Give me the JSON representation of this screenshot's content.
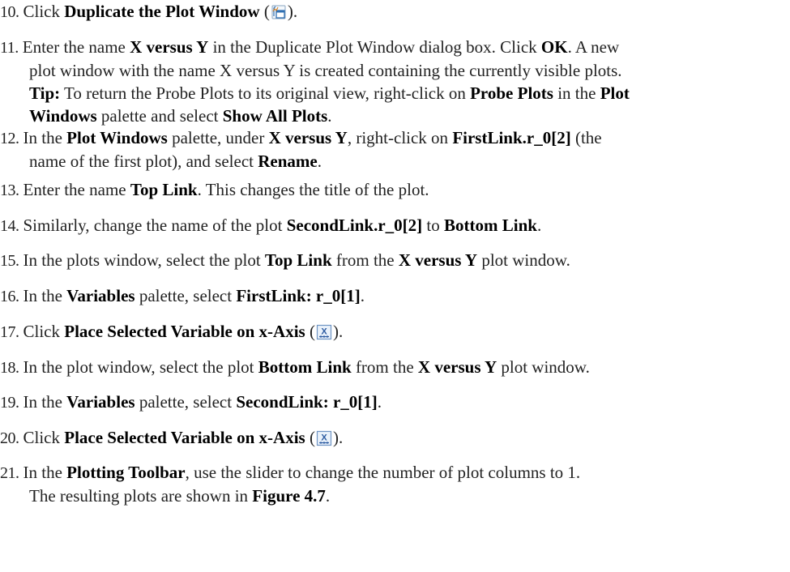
{
  "steps": [
    {
      "num": "10.",
      "lines": [
        [
          {
            "t": "Click "
          },
          {
            "t": "Duplicate the Plot Window",
            "b": true
          },
          {
            "t": " ("
          },
          {
            "icon": "duplicate-window-icon"
          },
          {
            "t": ")."
          }
        ]
      ]
    },
    {
      "num": "11.",
      "lines": [
        [
          {
            "t": "Enter the name "
          },
          {
            "t": "X versus Y",
            "b": true
          },
          {
            "t": " in the Duplicate Plot Window dialog box. Click "
          },
          {
            "t": "OK",
            "b": true
          },
          {
            "t": ". A new"
          }
        ],
        [
          {
            "t": "plot window with the name X versus Y is created containing the currently visible plots."
          }
        ],
        [
          {
            "t": "Tip:",
            "b": true
          },
          {
            "t": " To return the Probe Plots to its original view, right-click on "
          },
          {
            "t": "Probe Plots",
            "b": true
          },
          {
            "t": " in the "
          },
          {
            "t": "Plot",
            "b": true
          }
        ],
        [
          {
            "t": "Windows",
            "b": true
          },
          {
            "t": " palette and select "
          },
          {
            "t": "Show All Plots",
            "b": true
          },
          {
            "t": "."
          }
        ]
      ]
    },
    {
      "num": "12.",
      "lines": [
        [
          {
            "t": "In the "
          },
          {
            "t": "Plot Windows",
            "b": true
          },
          {
            "t": " palette, under "
          },
          {
            "t": "X versus Y",
            "b": true
          },
          {
            "t": ", right-click on "
          },
          {
            "t": "FirstLink.r_0[2]",
            "b": true
          },
          {
            "t": " (the"
          }
        ],
        [
          {
            "t": "name of the first plot), and select "
          },
          {
            "t": "Rename",
            "b": true
          },
          {
            "t": "."
          }
        ]
      ]
    },
    {
      "num": "13.",
      "lines": [
        [
          {
            "t": "Enter the name "
          },
          {
            "t": "Top Link",
            "b": true
          },
          {
            "t": ". This changes the title of the plot."
          }
        ]
      ]
    },
    {
      "num": "14.",
      "lines": [
        [
          {
            "t": "Similarly, change the name of the plot "
          },
          {
            "t": "SecondLink.r_0[2]",
            "b": true
          },
          {
            "t": " to "
          },
          {
            "t": "Bottom Link",
            "b": true
          },
          {
            "t": "."
          }
        ]
      ]
    },
    {
      "num": "15.",
      "lines": [
        [
          {
            "t": "In the plots window, select the plot "
          },
          {
            "t": "Top Link",
            "b": true
          },
          {
            "t": " from the "
          },
          {
            "t": "X versus Y",
            "b": true
          },
          {
            "t": " plot window."
          }
        ]
      ]
    },
    {
      "num": "16.",
      "lines": [
        [
          {
            "t": "In the "
          },
          {
            "t": "Variables",
            "b": true
          },
          {
            "t": " palette, select "
          },
          {
            "t": "FirstLink: r_0[1]",
            "b": true
          },
          {
            "t": "."
          }
        ]
      ]
    },
    {
      "num": "17.",
      "lines": [
        [
          {
            "t": "Click "
          },
          {
            "t": "Place Selected Variable on x-Axis",
            "b": true
          },
          {
            "t": " ("
          },
          {
            "icon": "x-axis-icon"
          },
          {
            "t": ")."
          }
        ]
      ]
    },
    {
      "num": "18.",
      "lines": [
        [
          {
            "t": "In the plot window, select the plot "
          },
          {
            "t": "Bottom Link",
            "b": true
          },
          {
            "t": " from the "
          },
          {
            "t": "X versus Y",
            "b": true
          },
          {
            "t": " plot window."
          }
        ]
      ]
    },
    {
      "num": "19.",
      "lines": [
        [
          {
            "t": "In the "
          },
          {
            "t": "Variables",
            "b": true
          },
          {
            "t": " palette, select "
          },
          {
            "t": "SecondLink: r_0[1]",
            "b": true
          },
          {
            "t": "."
          }
        ]
      ]
    },
    {
      "num": "20.",
      "lines": [
        [
          {
            "t": "Click "
          },
          {
            "t": "Place Selected Variable on x-Axis",
            "b": true
          },
          {
            "t": " ("
          },
          {
            "icon": "x-axis-icon"
          },
          {
            "t": ")."
          }
        ]
      ]
    },
    {
      "num": "21.",
      "lines": [
        [
          {
            "t": "In the "
          },
          {
            "t": "Plotting Toolbar",
            "b": true
          },
          {
            "t": ", use the slider to change the number of plot columns to 1."
          }
        ],
        [
          {
            "t": "The resulting plots are shown in "
          },
          {
            "t": "Figure 4.7",
            "b": true
          },
          {
            "t": "."
          }
        ]
      ]
    }
  ]
}
